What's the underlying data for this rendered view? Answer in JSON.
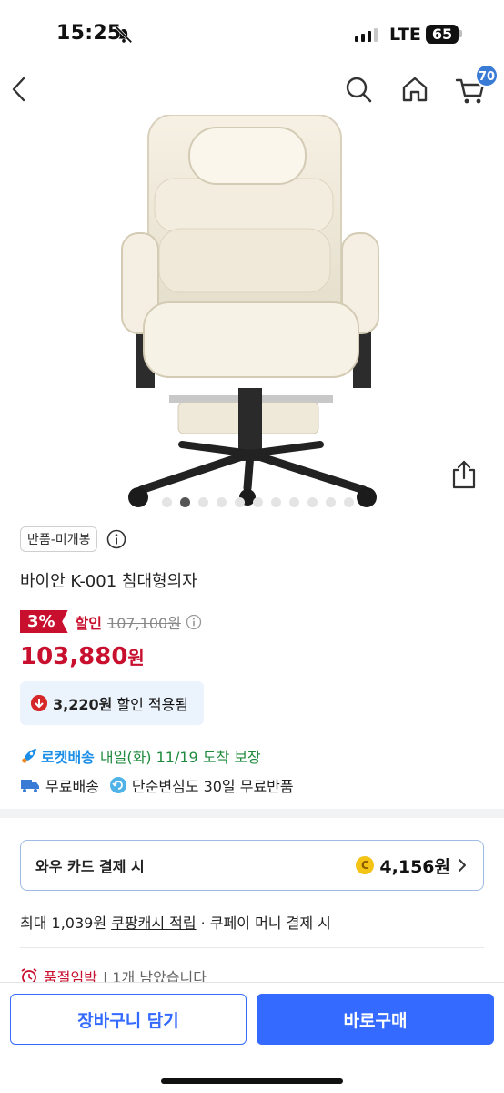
{
  "status_bar": {
    "time": "15:25",
    "network": "LTE",
    "battery": "65"
  },
  "navbar": {
    "icons": [
      "back-icon",
      "search-icon",
      "home-icon",
      "cart-icon"
    ],
    "cart_count": "70"
  },
  "gallery": {
    "total_images": 11,
    "active_index": 1
  },
  "product": {
    "tag": "반품-미개봉",
    "title": "바이안 K-001 침대형의자",
    "discount_rate": "3%",
    "sale_label": "할인",
    "original_price": "107,100원",
    "final_price_number": "103,880",
    "final_price_unit": "원",
    "coupon_amount": "3,220원",
    "coupon_text": "할인 적용됨"
  },
  "delivery": {
    "rocket_label": "로켓배송",
    "arrival": "내일(화) 11/19 도착 보장",
    "free_shipping": "무료배송",
    "free_return": "단순변심도 30일 무료반품"
  },
  "wow_card": {
    "label": "와우 카드 결제 시",
    "coin_symbol": "C",
    "amount": "4,156원"
  },
  "cash": {
    "prefix": "최대 1,039원",
    "link": "쿠팡캐시 적립",
    "suffix": "· 쿠페이 머니 결제 시"
  },
  "stock": {
    "urgent": "품절임박",
    "rest": "| 1개 남았습니다"
  },
  "buttons": {
    "cart": "장바구니 담기",
    "buy": "바로구매"
  },
  "colors": {
    "accent": "#346aff",
    "sale_red": "#c8102e",
    "rocket_blue": "#1b8ee8",
    "arrival_green": "#1f8a3d"
  }
}
